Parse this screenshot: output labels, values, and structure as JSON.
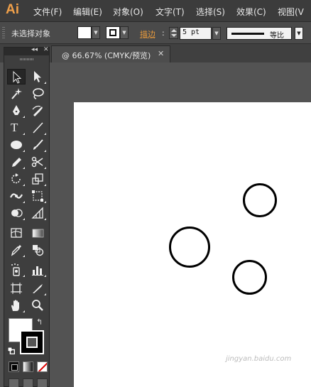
{
  "app": {
    "logo": "Ai"
  },
  "menu": {
    "items": [
      {
        "label": "文件(F)"
      },
      {
        "label": "编辑(E)"
      },
      {
        "label": "对象(O)"
      },
      {
        "label": "文字(T)"
      },
      {
        "label": "选择(S)"
      },
      {
        "label": "效果(C)"
      },
      {
        "label": "视图(V"
      }
    ]
  },
  "control_bar": {
    "selection_status": "未选择对象",
    "fill_color": "#ffffff",
    "stroke_label": "描边",
    "stroke_colon": ":",
    "stroke_weight": "5 pt",
    "profile_label": "等比"
  },
  "document_tab": {
    "label": "@ 66.67% (CMYK/预览)",
    "close": "✕"
  },
  "tools_panel": {
    "collapse": "◂◂",
    "close": "✕",
    "swap": "↰"
  },
  "colors": {
    "accent_orange": "#e89a3c",
    "logo_orange": "#f0a04a",
    "ui_dark": "#535353",
    "artboard": "#ffffff",
    "shape_stroke": "#000000"
  },
  "watermark": {
    "text": "jingyan.baidu.com"
  }
}
